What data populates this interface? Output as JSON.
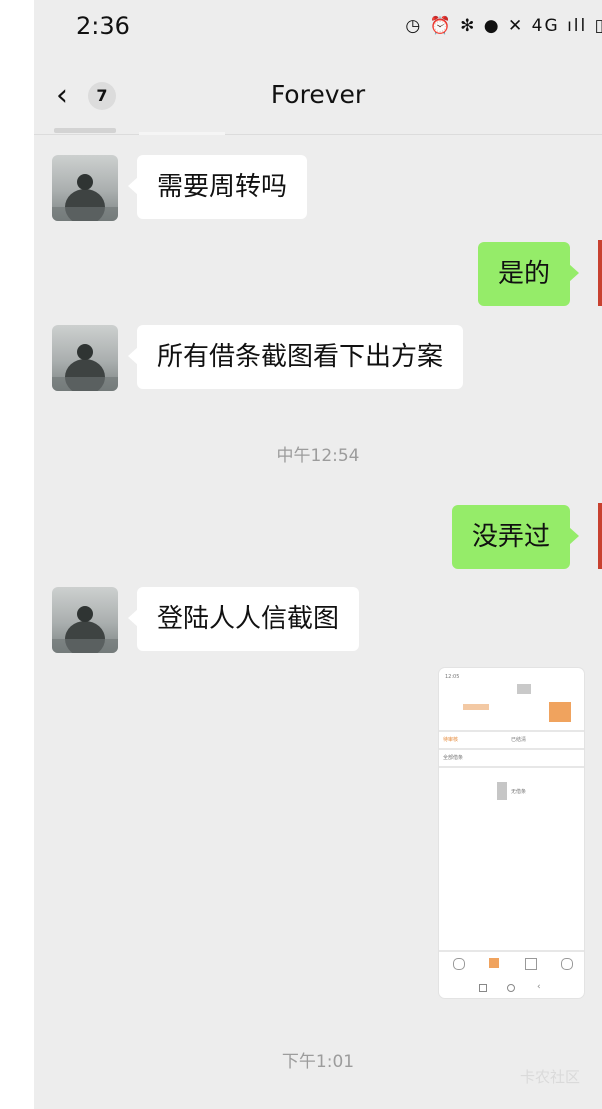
{
  "status_bar": {
    "time": "2:36",
    "icons_text": "◷ ⏰ ✻ ● ✕ 4G ıll ▯",
    "network": "4G"
  },
  "header": {
    "back_badge": "7",
    "title": "Forever"
  },
  "messages": {
    "m1": "需要周转吗",
    "m2": "是的",
    "m3": "所有借条截图看下出方案",
    "t1": "中午12:54",
    "m4": "没弄过",
    "m5": "登陆人人信截图",
    "t2": "下午1:01"
  },
  "thumbnail": {
    "time": "12:05",
    "items": [
      "待审核",
      "已结清",
      "全部借条"
    ],
    "empty_label": "无借条"
  },
  "watermark": "卡农社区",
  "colors": {
    "background": "#ededed",
    "incoming_bubble": "#ffffff",
    "outgoing_bubble": "#95ec69",
    "accent_orange": "#f0a35e"
  }
}
